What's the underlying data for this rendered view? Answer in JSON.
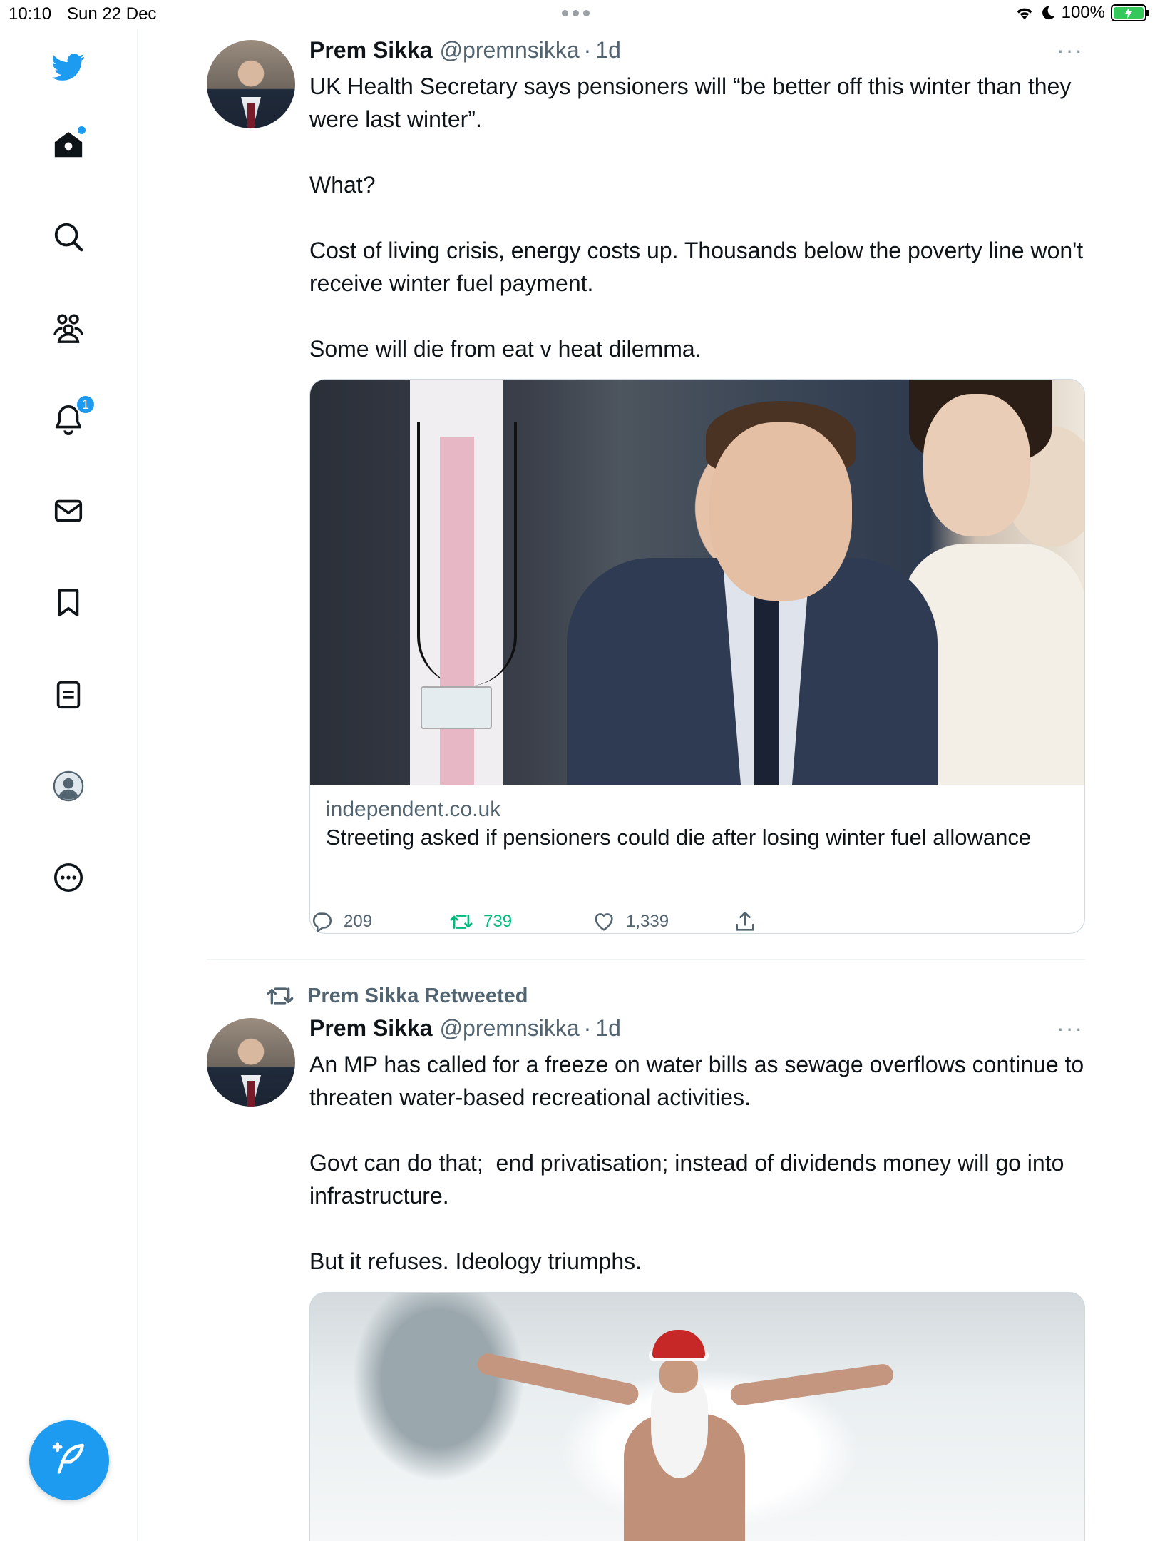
{
  "status_bar": {
    "time": "10:10",
    "date": "Sun 22 Dec",
    "battery": "100%"
  },
  "sidebar": {
    "items": [
      {
        "name": "twitter-logo",
        "icon": "twitter-bird-icon"
      },
      {
        "name": "home",
        "icon": "home-icon",
        "has_dot": true
      },
      {
        "name": "explore",
        "icon": "search-icon"
      },
      {
        "name": "communities",
        "icon": "communities-icon"
      },
      {
        "name": "notifications",
        "icon": "bell-icon",
        "badge": "1"
      },
      {
        "name": "messages",
        "icon": "envelope-icon"
      },
      {
        "name": "bookmarks",
        "icon": "bookmark-icon"
      },
      {
        "name": "lists",
        "icon": "list-icon"
      },
      {
        "name": "profile",
        "icon": "profile-avatar-icon"
      },
      {
        "name": "more",
        "icon": "more-circle-icon"
      }
    ],
    "compose_icon": "compose-feather-icon",
    "accent": "#1d9bf0"
  },
  "tweets": [
    {
      "name": "Prem Sikka",
      "handle": "@premnsikka",
      "sep": "·",
      "time": "1d",
      "more": "···",
      "text": "UK Health Secretary says pensioners will “be better off this winter than they were last winter”.\n\nWhat?\n\nCost of living crisis, energy costs up. Thousands below the poverty line won't receive winter fuel payment.\n\nSome will die from eat v heat dilemma.",
      "card": {
        "domain": "independent.co.uk",
        "title": "Streeting asked if pensioners could die after losing winter fuel allowance"
      },
      "stats": {
        "replies": "209",
        "retweets": "739",
        "likes": "1,339"
      }
    },
    {
      "retweeted_by": "Prem Sikka Retweeted",
      "name": "Prem Sikka",
      "handle": "@premnsikka",
      "sep": "·",
      "time": "1d",
      "more": "···",
      "text": "An MP has called for a freeze on water bills as sewage overflows continue to threaten water-based recreational activities.\n\nGovt can do that;  end privatisation; instead of dividends money will go into infrastructure.\n\nBut it refuses. Ideology triumphs."
    }
  ],
  "colors": {
    "retweet_green": "#00ba7c",
    "secondary_text": "#536471"
  }
}
